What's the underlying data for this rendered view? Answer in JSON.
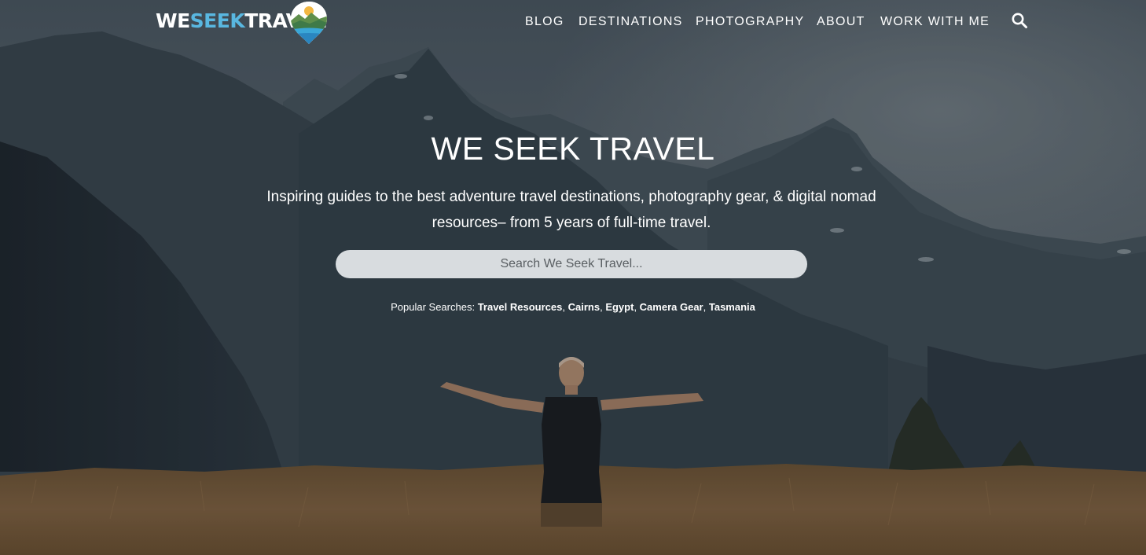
{
  "header": {
    "logo": {
      "we": "WE",
      "seek": "SEEK",
      "travel": "TRAVEL"
    },
    "nav": [
      {
        "label": "BLOG"
      },
      {
        "label": "DESTINATIONS"
      },
      {
        "label": "PHOTOGRAPHY"
      },
      {
        "label": "ABOUT"
      },
      {
        "label": "WORK WITH ME"
      }
    ],
    "search_icon": "search-icon"
  },
  "hero": {
    "title": "WE SEEK TRAVEL",
    "subtitle": "Inspiring guides to the best adventure travel destinations, photography gear, & digital nomad resources– from 5 years of full-time travel.",
    "search_placeholder": "Search We Seek Travel...",
    "popular_label": "Popular Searches:",
    "popular": [
      {
        "label": "Travel Resources"
      },
      {
        "label": "Cairns"
      },
      {
        "label": "Egypt"
      },
      {
        "label": "Camera Gear"
      },
      {
        "label": "Tasmania"
      }
    ]
  },
  "colors": {
    "logo_accent": "#59b7e0",
    "text": "#ffffff",
    "search_bg": "#d8dcdf"
  }
}
